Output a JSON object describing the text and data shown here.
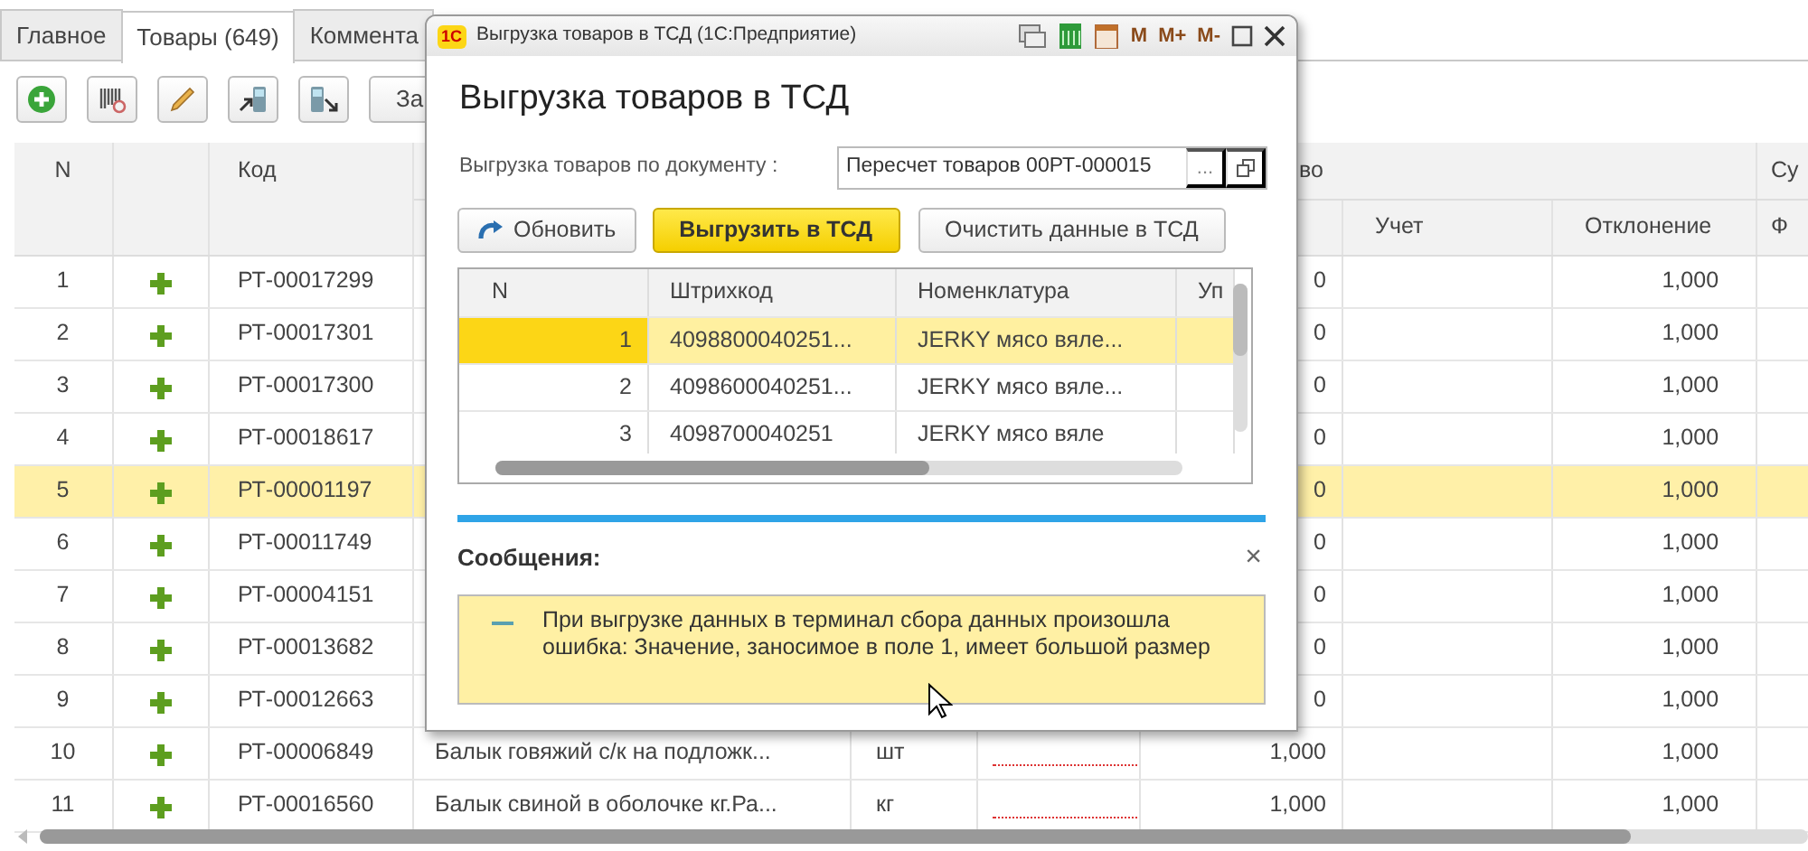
{
  "tabs": [
    {
      "label": "Главное",
      "selected": false
    },
    {
      "label": "Товары (649)",
      "selected": true
    },
    {
      "label": "Коммента",
      "selected": false
    }
  ],
  "toolbar": {
    "last_button": "За"
  },
  "table": {
    "header": {
      "n": "N",
      "code": "Код",
      "group_quantity": "во",
      "group_sum": "Су",
      "accounted": "Учет",
      "deviation": "Отклонение",
      "sum_fact": "Ф"
    },
    "rows": [
      {
        "n": "1",
        "code": "РТ-00017299",
        "quantity": "0",
        "deviation": "1,000",
        "selected": false
      },
      {
        "n": "2",
        "code": "РТ-00017301",
        "quantity": "0",
        "deviation": "1,000",
        "selected": false
      },
      {
        "n": "3",
        "code": "РТ-00017300",
        "quantity": "0",
        "deviation": "1,000",
        "selected": false
      },
      {
        "n": "4",
        "code": "РТ-00018617",
        "quantity": "0",
        "deviation": "1,000",
        "selected": false
      },
      {
        "n": "5",
        "code": "РТ-00001197",
        "quantity": "0",
        "deviation": "1,000",
        "selected": true
      },
      {
        "n": "6",
        "code": "РТ-00011749",
        "quantity": "0",
        "deviation": "1,000",
        "selected": false
      },
      {
        "n": "7",
        "code": "РТ-00004151",
        "quantity": "0",
        "deviation": "1,000",
        "selected": false
      },
      {
        "n": "8",
        "code": "РТ-00013682",
        "quantity": "0",
        "deviation": "1,000",
        "selected": false
      },
      {
        "n": "9",
        "code": "РТ-00012663",
        "quantity": "0",
        "deviation": "1,000",
        "selected": false
      },
      {
        "n": "10",
        "code": "РТ-00006849",
        "name": "Балык говяжий с/к на подложк...",
        "unit": "шт",
        "quantity": "1,000",
        "deviation": "1,000",
        "selected": false,
        "missing_value": true
      },
      {
        "n": "11",
        "code": "РТ-00016560",
        "name": "Балык свиной в оболочке кг.Ра...",
        "unit": "кг",
        "quantity": "1,000",
        "deviation": "1,000",
        "selected": false,
        "missing_value": true
      }
    ]
  },
  "dialog": {
    "logo": "1С",
    "window_title": "Выгрузка товаров в ТСД  (1С:Предприятие)",
    "memory_buttons": [
      "M",
      "M+",
      "M-"
    ],
    "heading": "Выгрузка товаров в ТСД",
    "document_label": "Выгрузка товаров по документу :",
    "document_value": "Пересчет товаров 00РТ-000015",
    "choose_button": "...",
    "buttons": [
      {
        "label": "Обновить",
        "kind": "refresh"
      },
      {
        "label": "Выгрузить в ТСД",
        "kind": "primary"
      },
      {
        "label": "Очистить данные в ТСД",
        "kind": "plain"
      }
    ],
    "grid": {
      "columns": [
        "N",
        "Штрихкод",
        "Номенклатура",
        "Уп"
      ],
      "rows": [
        {
          "n": "1",
          "barcode": "4098800040251...",
          "item": "JERKY мясо вяле...",
          "selected": true
        },
        {
          "n": "2",
          "barcode": "4098600040251...",
          "item": "JERKY мясо вяле...",
          "selected": false
        },
        {
          "n": "3",
          "barcode": "4098700040251",
          "item": "JERKY мясо вяле",
          "selected": false
        }
      ]
    },
    "messages": {
      "title": "Сообщения:",
      "close": "×",
      "items": [
        {
          "text": "При выгрузке данных в терминал сбора данных произошла ошибка: Значение, заносимое в поле 1, имеет большой размер"
        }
      ]
    }
  }
}
